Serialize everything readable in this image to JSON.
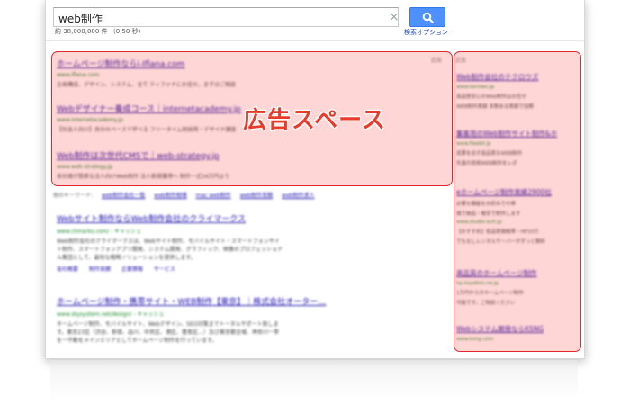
{
  "search": {
    "query": "web制作",
    "stats": "約 38,000,000 件 （0.50 秒）",
    "options_link": "検索オプション",
    "clear_icon": "×",
    "button_icon": "search-icon"
  },
  "ads": {
    "label_top": "広告",
    "label_right": "広告",
    "top": [
      {
        "title": "ホームページ制作ならi-Iflana.com",
        "url": "www.iflana.com",
        "snippet": "企画構成、デザイン、システム、全て ティファナにお任せ。まずはご相談"
      },
      {
        "title": "Webデザイナー養成コース｜internetacademy.jp",
        "url": "www.internetacademy.jp",
        "snippet": "【社会人向け】自分のペースで学べる フリータイム制採用・デザイナ講座"
      },
      {
        "title": "Web制作は次世代CMSで｜web-strategy.jp",
        "url": "www.web-strategy.jp",
        "snippet": "各社様が簡単な法人向けWeb制作 法人新規獲得へ 制作一式34万円より"
      }
    ],
    "right": [
      {
        "title": "Web制作会社のテクロウズ",
        "line1": "高品質安心のWeb制作はお任せ",
        "line2": "WEB制作実績 多数ある実績で信頼",
        "url": "www.tarrows.jp"
      },
      {
        "title": "集客用のWeb制作サイト制作&ホ",
        "line1": "成果を出す高品質なWEB制作",
        "line2": "先進の技術WEB制作をレポ",
        "url": "www.fiwebt.jp"
      },
      {
        "title": "eホームページ制作実績2900社",
        "line1": "必要な機能をお好みでの単",
        "line2": "価で納品・格安で制作します",
        "url": "www.studio-ecit.jp"
      },
      {
        "title": "",
        "line1": "【おすすめ】低品質価格帯・HP10万",
        "line2": "でもなしレンタルサーバーがずっと無料",
        "url": ""
      },
      {
        "title": "高品質のホームページ制作",
        "line1": "1万円からのホームページ制作",
        "line2": "可能です。ご相談ください",
        "url": "hp.myoltrin.ne.jp"
      },
      {
        "title": "Webシステム開発ならKSNG",
        "line1": "",
        "line2": "",
        "url": "www.ksng.com"
      }
    ]
  },
  "related": {
    "label": "他のキーワード:",
    "items": [
      "web制作会社一覧",
      "web制作相場",
      "mac web制作",
      "web制作見積",
      "web制作求人"
    ]
  },
  "results": [
    {
      "title": "Webサイト制作ならWeb制作会社のクライマークス",
      "url": "www.climarks.com/ - キャッシュ",
      "snippet1": "Web制作会社のクライマークスは、Webサイト制作、モバイルサイト・スマートフォンサイ",
      "snippet2": "ト制作、スマートフォンアプリ開発、システム開発、グラフィック、映像のプロフェッショナ",
      "snippet3": "ル集団として、最短な戦略ソリューションを提供します。",
      "links": [
        "会社概要",
        "制作実績",
        "企業情報",
        "サービス"
      ]
    },
    {
      "title": "ホームページ制作・携帯サイト・WEB制作【東京】｜株式会社オーター…",
      "url": "www.skysystem.net/design/ - キャッシュ",
      "snippet1": "ホームページ制作、モバイルサイト、Webデザイン、SEO対策までトータルサポート致しま",
      "snippet2": "す。東京23区（渋谷、新宿、品川、中央区、港区、豊島区…）及び東京都全域、神奈川一帯",
      "snippet3": "を一不動をメインエリアとしてホームページ制作を行っています。",
      "links": []
    }
  ],
  "overlay": {
    "label": "広告スペース",
    "color": "#e02a2a"
  }
}
